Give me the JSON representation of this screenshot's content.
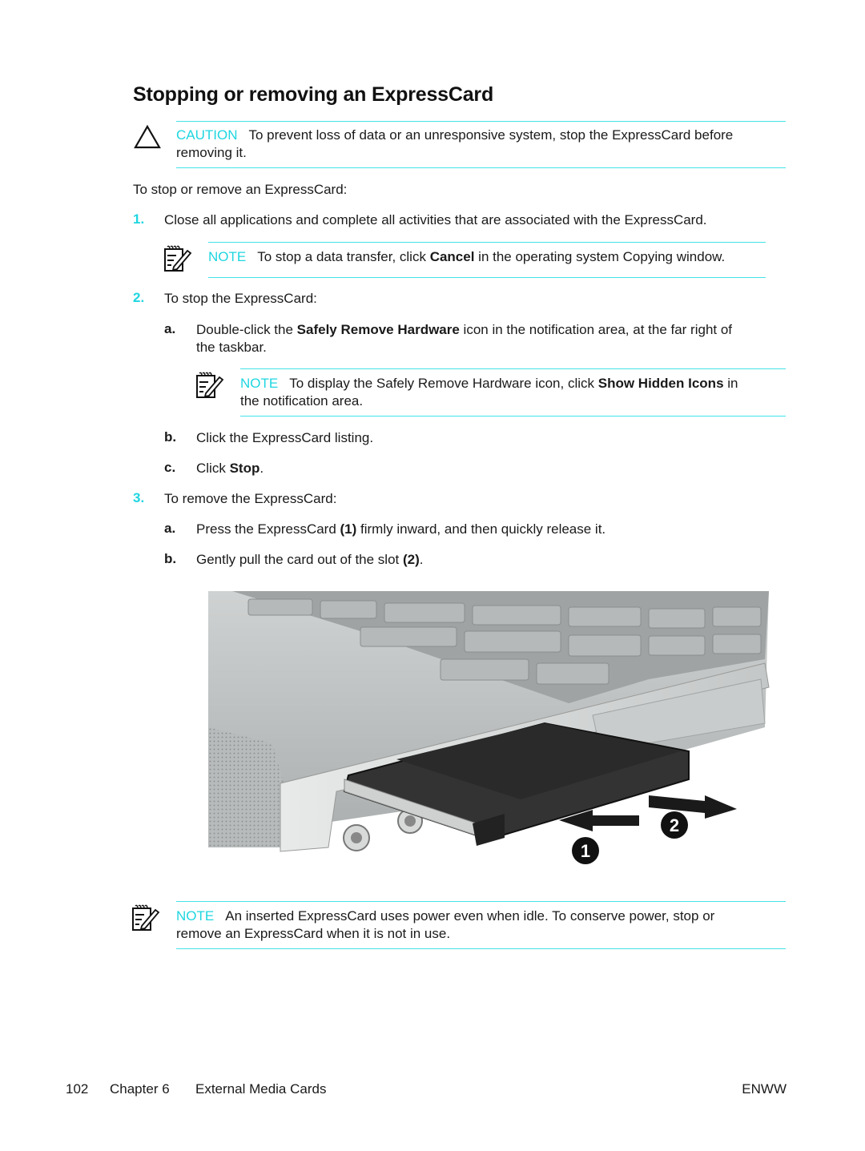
{
  "page": {
    "title": "Stopping or removing an ExpressCard",
    "caution": {
      "label": "CAUTION",
      "text_line1": "To prevent loss of data or an unresponsive system, stop the ExpressCard before",
      "text_line2": "removing it.",
      "icon": "caution-triangle-icon"
    },
    "intro": "To stop or remove an ExpressCard:",
    "steps": [
      {
        "number": "1.",
        "text": "Close all applications and complete all activities that are associated with the ExpressCard.",
        "note": {
          "label": "NOTE",
          "pre": "To stop a data transfer, click ",
          "bold": "Cancel",
          "post": " in the operating system Copying window.",
          "icon": "note-pencil-icon"
        }
      },
      {
        "number": "2.",
        "text": "To stop the ExpressCard:",
        "substeps": [
          {
            "letter": "a.",
            "pre": "Double-click the ",
            "bold": "Safely Remove Hardware",
            "post_line1": " icon in the notification area, at the far right of",
            "line2": "the taskbar.",
            "note": {
              "label": "NOTE",
              "pre": "To display the Safely Remove Hardware icon, click ",
              "bold": "Show Hidden Icons",
              "post": " in",
              "line2": "the notification area.",
              "icon": "note-pencil-icon"
            }
          },
          {
            "letter": "b.",
            "text": "Click the ExpressCard listing."
          },
          {
            "letter": "c.",
            "pre": "Click ",
            "bold": "Stop",
            "post": "."
          }
        ]
      },
      {
        "number": "3.",
        "text": "To remove the ExpressCard:",
        "substeps": [
          {
            "letter": "a.",
            "pre": "Press the ExpressCard ",
            "bold": "(1)",
            "post": " firmly inward, and then quickly release it."
          },
          {
            "letter": "b.",
            "pre": "Gently pull the card out of the slot ",
            "bold": "(2)",
            "post": "."
          }
        ]
      }
    ],
    "figure": {
      "description": "Illustration of an ExpressCard being removed from a notebook computer slot",
      "callouts": [
        "1",
        "2"
      ]
    },
    "final_note": {
      "label": "NOTE",
      "text_line1": "An inserted ExpressCard uses power even when idle. To conserve power, stop or",
      "text_line2": "remove an ExpressCard when it is not in use.",
      "icon": "note-pencil-icon"
    },
    "footer": {
      "page_number": "102",
      "chapter": "Chapter 6",
      "chapter_title": "External Media Cards",
      "locale": "ENWW"
    }
  }
}
